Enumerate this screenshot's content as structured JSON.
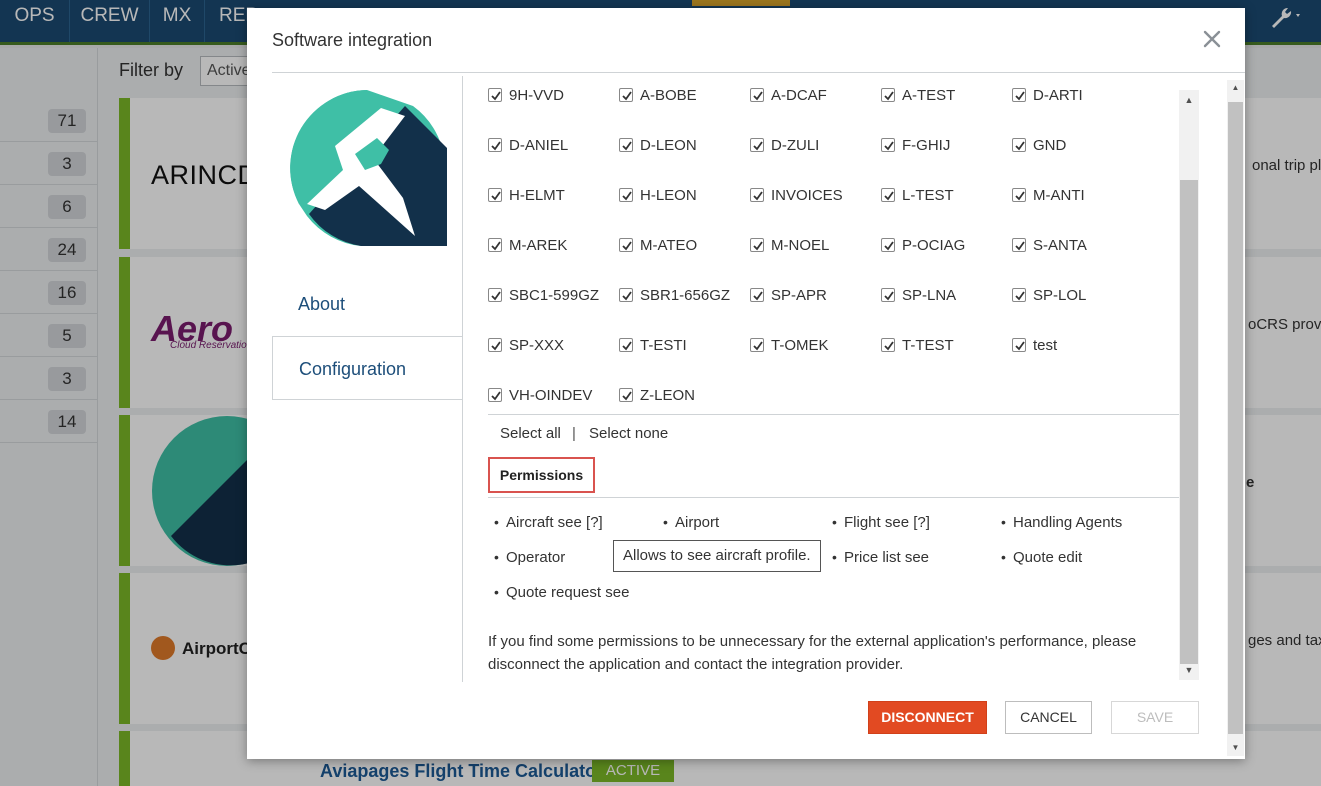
{
  "nav": {
    "items": [
      "OPS",
      "CREW",
      "MX",
      "REP"
    ]
  },
  "background": {
    "filter_label": "Filter by",
    "filter_value": "Active",
    "counts": [
      "71",
      "3",
      "6",
      "24",
      "16",
      "5",
      "3",
      "14"
    ],
    "card_fragments": {
      "arinc": "ARINCDi",
      "arinc_desc": "onal trip pla",
      "aero": "Aero",
      "aero_sub": "Cloud Reservation",
      "aero_desc": "oCRS provi",
      "card3_desc": "e",
      "airportc": "AirportC",
      "airportc_desc": "ges and tax"
    },
    "bottom_card": {
      "title": "Aviapages Flight Time Calculator",
      "status": "ACTIVE"
    }
  },
  "modal": {
    "title": "Software integration",
    "tabs": {
      "about": "About",
      "configuration": "Configuration"
    },
    "partial_row": [
      "9H-VVD",
      "A-BOBE",
      "A-DCAF",
      "A-TEST",
      "D-ARTI"
    ],
    "aircraft": [
      [
        "D-ANIEL",
        "D-LEON",
        "D-ZULI",
        "F-GHIJ",
        "GND"
      ],
      [
        "H-ELMT",
        "H-LEON",
        "INVOICES",
        "L-TEST",
        "M-ANTI"
      ],
      [
        "M-AREK",
        "M-ATEO",
        "M-NOEL",
        "P-OCIAG",
        "S-ANTA"
      ],
      [
        "SBC1-599GZ",
        "SBR1-656GZ",
        "SP-APR",
        "SP-LNA",
        "SP-LOL"
      ],
      [
        "SP-XXX",
        "T-ESTI",
        "T-OMEK",
        "T-TEST",
        "test"
      ],
      [
        "VH-OINDEV",
        "Z-LEON"
      ]
    ],
    "select_all": "Select all",
    "separator": "|",
    "select_none": "Select none",
    "permissions_tab": "Permissions",
    "permissions": [
      [
        "Aircraft see [?]",
        "Airport",
        "Flight see [?]",
        "Handling Agents"
      ],
      [
        "Operator",
        "",
        "Price list see",
        "Quote edit"
      ],
      [
        "Quote request see"
      ]
    ],
    "tooltip": "Allows to see aircraft profile.",
    "notice": "If you find some permissions to be unnecessary for the external application's performance, please disconnect the application and contact the integration provider.",
    "buttons": {
      "disconnect": "DISCONNECT",
      "cancel": "CANCEL",
      "save": "SAVE"
    }
  },
  "colors": {
    "topbar": "#1b4a72",
    "accent_green": "#7cb928",
    "disconnect_red": "#e24a22",
    "logo_teal": "#3fbfa6",
    "logo_navy": "#12304a",
    "permissions_outline": "#d9534f"
  },
  "icons": [
    "close-icon",
    "checkbox-checked-icon",
    "wrench-icon",
    "scroll-up-icon",
    "scroll-down-icon"
  ]
}
